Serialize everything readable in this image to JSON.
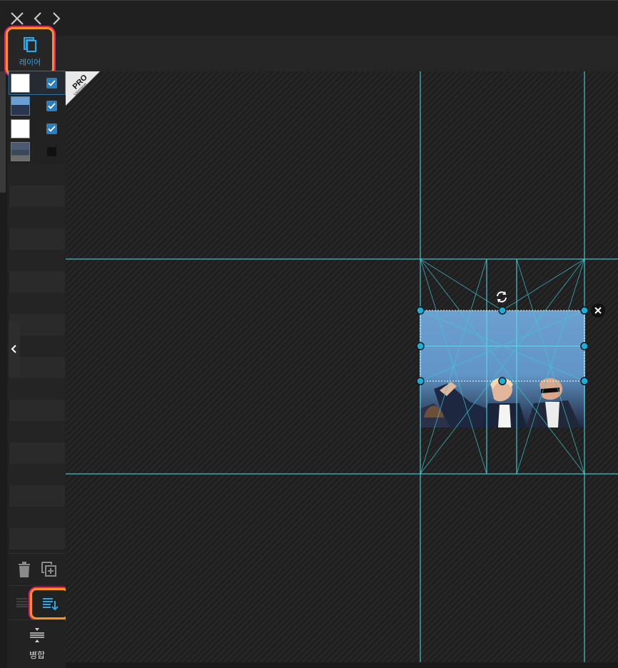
{
  "window": {
    "close_icon": "close-icon",
    "back_icon": "chevron-left-icon",
    "forward_icon": "chevron-right-icon"
  },
  "layer_panel": {
    "title": "레이어",
    "icon": "copy-layers-icon",
    "accent_color": "#2ea8e6",
    "highlight_colors": [
      "#f7931e",
      "#e2206f"
    ],
    "layers": [
      {
        "thumb": "white",
        "visible": true,
        "selected": true
      },
      {
        "thumb": "photo",
        "visible": true,
        "selected": false
      },
      {
        "thumb": "white",
        "visible": true,
        "selected": false
      },
      {
        "thumb": "landscape",
        "visible": false,
        "selected": false
      }
    ]
  },
  "badge": {
    "line1": "PRO",
    "line2": "Version"
  },
  "toolbar": {
    "delete_icon": "trash-icon",
    "duplicate_icon": "add-copy-icon",
    "reorder_icon": "drag-handle-icon",
    "sort_icon": "sort-down-icon",
    "merge_icon": "merge-icon",
    "merge_label": "병합"
  },
  "canvas": {
    "guide_color": "#4fe3f0",
    "handle_color": "#1bb0d8"
  }
}
